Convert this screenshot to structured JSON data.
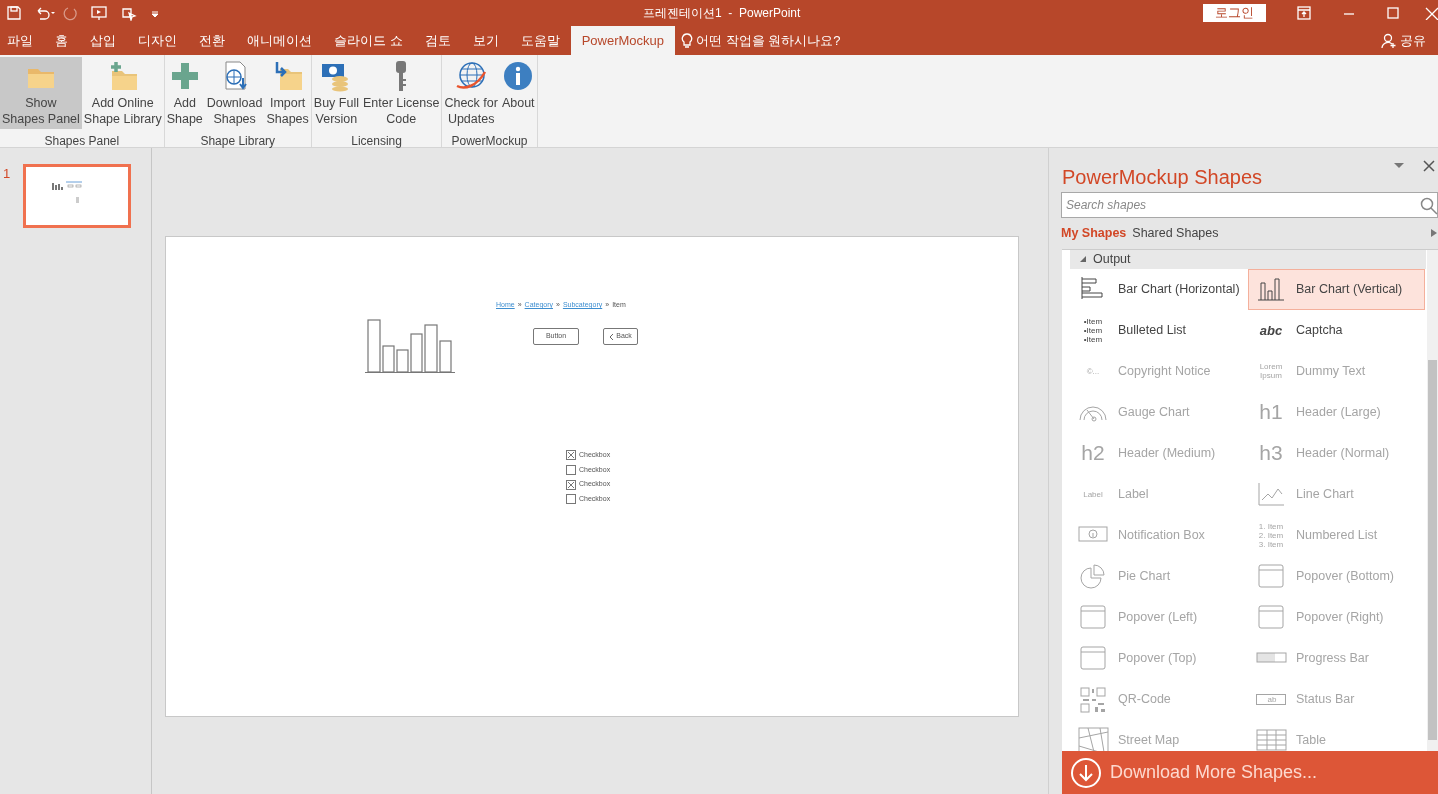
{
  "window": {
    "title": "프레젠테이션1  -  PowerPoint",
    "sign_in": "로그인"
  },
  "tabs": [
    {
      "label": "파일",
      "selected": false
    },
    {
      "label": "홈",
      "selected": false
    },
    {
      "label": "삽입",
      "selected": false
    },
    {
      "label": "디자인",
      "selected": false
    },
    {
      "label": "전환",
      "selected": false
    },
    {
      "label": "애니메이션",
      "selected": false
    },
    {
      "label": "슬라이드 쇼",
      "selected": false
    },
    {
      "label": "검토",
      "selected": false
    },
    {
      "label": "보기",
      "selected": false
    },
    {
      "label": "도움말",
      "selected": false
    },
    {
      "label": "PowerMockup",
      "selected": true
    }
  ],
  "tell_me": "어떤 작업을 원하시나요?",
  "share": "공유",
  "ribbon": [
    {
      "label": "Shapes Panel",
      "buttons": [
        {
          "lines": [
            "Show",
            "Shapes Panel"
          ],
          "kind": "folder",
          "selected": true
        },
        {
          "lines": [
            "Add Online",
            "Shape Library"
          ],
          "kind": "folder-plus",
          "selected": false
        }
      ]
    },
    {
      "label": "Shape Library",
      "buttons": [
        {
          "lines": [
            "Add",
            "Shape"
          ],
          "kind": "plus",
          "selected": false
        },
        {
          "lines": [
            "Download",
            "Shapes"
          ],
          "kind": "download",
          "selected": false
        },
        {
          "lines": [
            "Import",
            "Shapes"
          ],
          "kind": "import",
          "selected": false
        }
      ]
    },
    {
      "label": "Licensing",
      "buttons": [
        {
          "lines": [
            "Buy Full",
            "Version"
          ],
          "kind": "money",
          "selected": false
        },
        {
          "lines": [
            "Enter License",
            "Code"
          ],
          "kind": "key",
          "selected": false
        }
      ]
    },
    {
      "label": "PowerMockup",
      "buttons": [
        {
          "lines": [
            "Check for",
            "Updates"
          ],
          "kind": "globe",
          "selected": false
        },
        {
          "lines": [
            "About"
          ],
          "kind": "info",
          "selected": false
        }
      ]
    }
  ],
  "slides": [
    {
      "number": "1",
      "selected": true
    }
  ],
  "slide": {
    "breadcrumb": [
      "Home",
      "Category",
      "Subcategory",
      "Item"
    ],
    "separator": "»",
    "button": "Button",
    "back": "Back",
    "checkboxes": [
      {
        "label": "Checkbox",
        "checked": true
      },
      {
        "label": "Checkbox",
        "checked": false
      },
      {
        "label": "Checkbox",
        "checked": true
      },
      {
        "label": "Checkbox",
        "checked": false
      }
    ]
  },
  "panel": {
    "title": "PowerMockup Shapes",
    "search": {
      "placeholder": "Search shapes"
    },
    "tabs": [
      {
        "label": "My Shapes",
        "selected": true
      },
      {
        "label": "Shared Shapes",
        "selected": false
      }
    ],
    "category": "Output",
    "items": [
      {
        "label": "Bar Chart (Horizontal)",
        "kind": "hbar",
        "disabled": false,
        "selected": false
      },
      {
        "label": "Bar Chart (Vertical)",
        "kind": "vbar",
        "disabled": false,
        "selected": true
      },
      {
        "label": "Bulleted List",
        "kind": "text",
        "icon_text": [
          "•Item",
          "•Item",
          "•Item"
        ],
        "disabled": false,
        "selected": false
      },
      {
        "label": "Captcha",
        "kind": "captcha",
        "icon_text": [
          "abc"
        ],
        "disabled": false,
        "selected": false
      },
      {
        "label": "Copyright Notice",
        "kind": "text",
        "icon_text": [
          "©..."
        ],
        "disabled": true,
        "selected": false
      },
      {
        "label": "Dummy Text",
        "kind": "text",
        "icon_text": [
          "Lorem",
          "Ipsum"
        ],
        "disabled": true,
        "selected": false
      },
      {
        "label": "Gauge Chart",
        "kind": "gauge",
        "disabled": true,
        "selected": false
      },
      {
        "label": "Header (Large)",
        "kind": "big",
        "icon_text": [
          "h1"
        ],
        "disabled": true,
        "selected": false
      },
      {
        "label": "Header (Medium)",
        "kind": "big",
        "icon_text": [
          "h2"
        ],
        "disabled": true,
        "selected": false
      },
      {
        "label": "Header (Normal)",
        "kind": "big",
        "icon_text": [
          "h3"
        ],
        "disabled": true,
        "selected": false
      },
      {
        "label": "Label",
        "kind": "text",
        "icon_text": [
          "Label"
        ],
        "disabled": true,
        "selected": false
      },
      {
        "label": "Line Chart",
        "kind": "line",
        "disabled": true,
        "selected": false
      },
      {
        "label": "Notification Box",
        "kind": "info",
        "disabled": true,
        "selected": false
      },
      {
        "label": "Numbered List",
        "kind": "text",
        "icon_text": [
          "1. Item",
          "2. Item",
          "3. Item"
        ],
        "disabled": true,
        "selected": false
      },
      {
        "label": "Pie Chart",
        "kind": "pie",
        "disabled": true,
        "selected": false
      },
      {
        "label": "Popover (Bottom)",
        "kind": "popover",
        "disabled": true,
        "selected": false
      },
      {
        "label": "Popover (Left)",
        "kind": "popover",
        "disabled": true,
        "selected": false
      },
      {
        "label": "Popover (Right)",
        "kind": "popover",
        "disabled": true,
        "selected": false
      },
      {
        "label": "Popover (Top)",
        "kind": "popover",
        "disabled": true,
        "selected": false
      },
      {
        "label": "Progress Bar",
        "kind": "progress",
        "disabled": true,
        "selected": false
      },
      {
        "label": "QR-Code",
        "kind": "qr",
        "disabled": true,
        "selected": false
      },
      {
        "label": "Status Bar",
        "kind": "status",
        "icon_text": [
          "ab"
        ],
        "disabled": true,
        "selected": false
      },
      {
        "label": "Street Map",
        "kind": "map",
        "disabled": true,
        "selected": false
      },
      {
        "label": "Table",
        "kind": "table",
        "disabled": true,
        "selected": false
      }
    ],
    "download": "Download More Shapes..."
  }
}
